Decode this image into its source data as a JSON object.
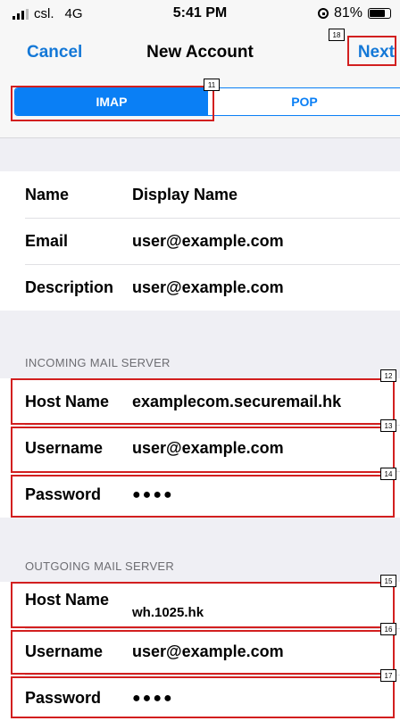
{
  "status": {
    "carrier": "csl.",
    "network": "4G",
    "time": "5:41 PM",
    "battery_percent": "81%",
    "battery_level": 0.81
  },
  "nav": {
    "cancel": "Cancel",
    "title": "New Account",
    "next": "Next"
  },
  "segments": {
    "imap": "IMAP",
    "pop": "POP",
    "selected": "IMAP"
  },
  "account": [
    {
      "label": "Name",
      "value": "Display Name"
    },
    {
      "label": "Email",
      "value": "user@example.com"
    },
    {
      "label": "Description",
      "value": "user@example.com"
    }
  ],
  "incoming": {
    "header": "INCOMING MAIL SERVER",
    "rows": [
      {
        "label": "Host Name",
        "value": "examplecom.securemail.hk"
      },
      {
        "label": "Username",
        "value": "user@example.com"
      },
      {
        "label": "Password",
        "value": "●●●●"
      }
    ]
  },
  "outgoing": {
    "header": "OUTGOING MAIL SERVER",
    "rows": [
      {
        "label": "Host Name",
        "value": "wh.1025.hk"
      },
      {
        "label": "Username",
        "value": "user@example.com"
      },
      {
        "label": "Password",
        "value": "●●●●"
      }
    ]
  },
  "annotations": [
    "11",
    "12",
    "13",
    "14",
    "15",
    "16",
    "17",
    "18"
  ]
}
